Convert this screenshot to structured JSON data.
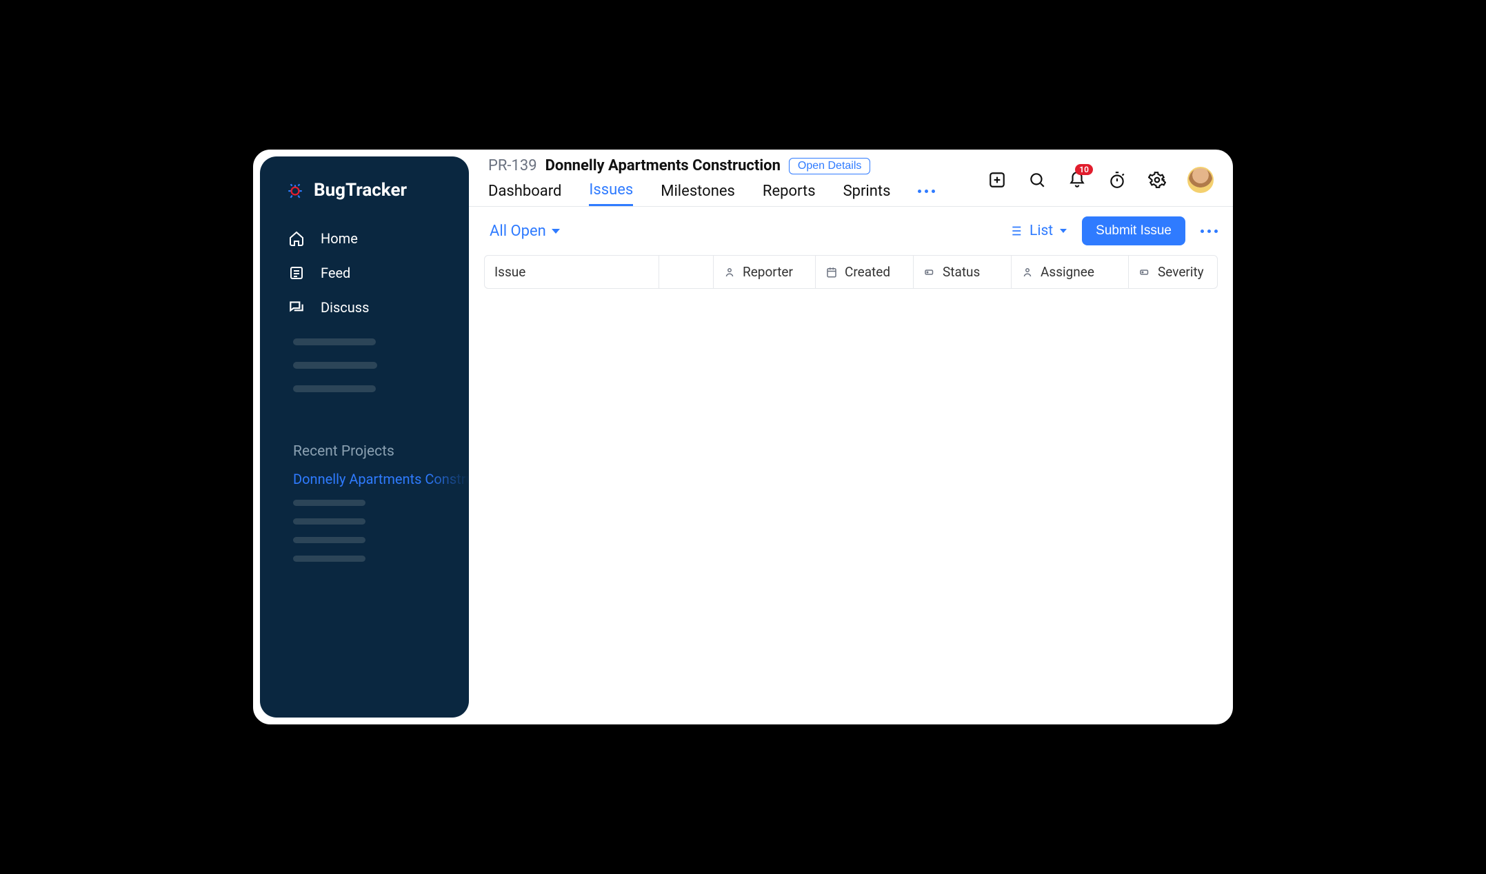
{
  "app": {
    "name": "BugTracker"
  },
  "sidebar": {
    "nav": [
      {
        "label": "Home"
      },
      {
        "label": "Feed"
      },
      {
        "label": "Discuss"
      }
    ],
    "recent_title": "Recent Projects",
    "recent_project": "Donnelly Apartments Construction"
  },
  "header": {
    "project_code": "PR-139",
    "project_name": "Donnelly Apartments Construction",
    "open_details": "Open Details",
    "tabs": [
      {
        "label": "Dashboard"
      },
      {
        "label": "Issues"
      },
      {
        "label": "Milestones"
      },
      {
        "label": "Reports"
      },
      {
        "label": "Sprints"
      }
    ],
    "active_tab": "Issues",
    "notifications_count": "10"
  },
  "filter": {
    "selected": "All Open",
    "view_label": "List",
    "submit_label": "Submit Issue"
  },
  "table": {
    "columns": {
      "issue": "Issue",
      "reporter": "Reporter",
      "created": "Created",
      "status": "Status",
      "assignee": "Assignee",
      "severity": "Severity"
    }
  }
}
